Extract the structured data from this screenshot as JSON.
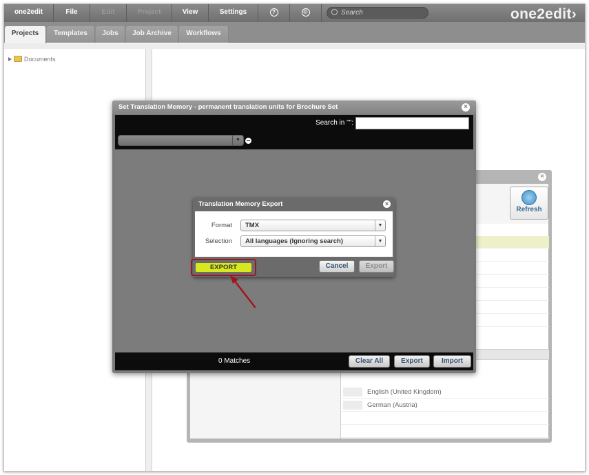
{
  "menubar": {
    "items": [
      {
        "label": "one2edit",
        "disabled": false
      },
      {
        "label": "File",
        "disabled": false
      },
      {
        "label": "Edit",
        "disabled": true
      },
      {
        "label": "Project",
        "disabled": true
      },
      {
        "label": "View",
        "disabled": false
      },
      {
        "label": "Settings",
        "disabled": false
      }
    ],
    "help_icon": "?",
    "copyright_icon": "©",
    "search_placeholder": "Search",
    "logo": "one2edit›"
  },
  "tabs": [
    {
      "label": "Projects",
      "active": true
    },
    {
      "label": "Templates",
      "active": false
    },
    {
      "label": "Jobs",
      "active": false
    },
    {
      "label": "Job Archive",
      "active": false
    },
    {
      "label": "Workflows",
      "active": false
    }
  ],
  "tree": {
    "root_label": "Documents"
  },
  "background_window": {
    "refresh_label": "Refresh",
    "languages": [
      "English (United Kingdom)",
      "German (Austria)"
    ]
  },
  "main_dialog": {
    "title": "Set Translation Memory - permanent translation units for Brochure Set",
    "search_label": "Search in \"\":",
    "search_value": "",
    "matches": "0 Matches",
    "buttons": {
      "clear_all": "Clear All",
      "export": "Export",
      "import": "Import"
    }
  },
  "export_dialog": {
    "title": "Translation Memory Export",
    "format_label": "Format",
    "format_value": "TMX",
    "selection_label": "Selection",
    "selection_value": "All languages (Ignoring search)",
    "cancel_label": "Cancel",
    "export_label": "Export"
  },
  "callout": {
    "label": "EXPORT",
    "highlight_color": "#d8e81f",
    "border_color": "#a2141e"
  }
}
